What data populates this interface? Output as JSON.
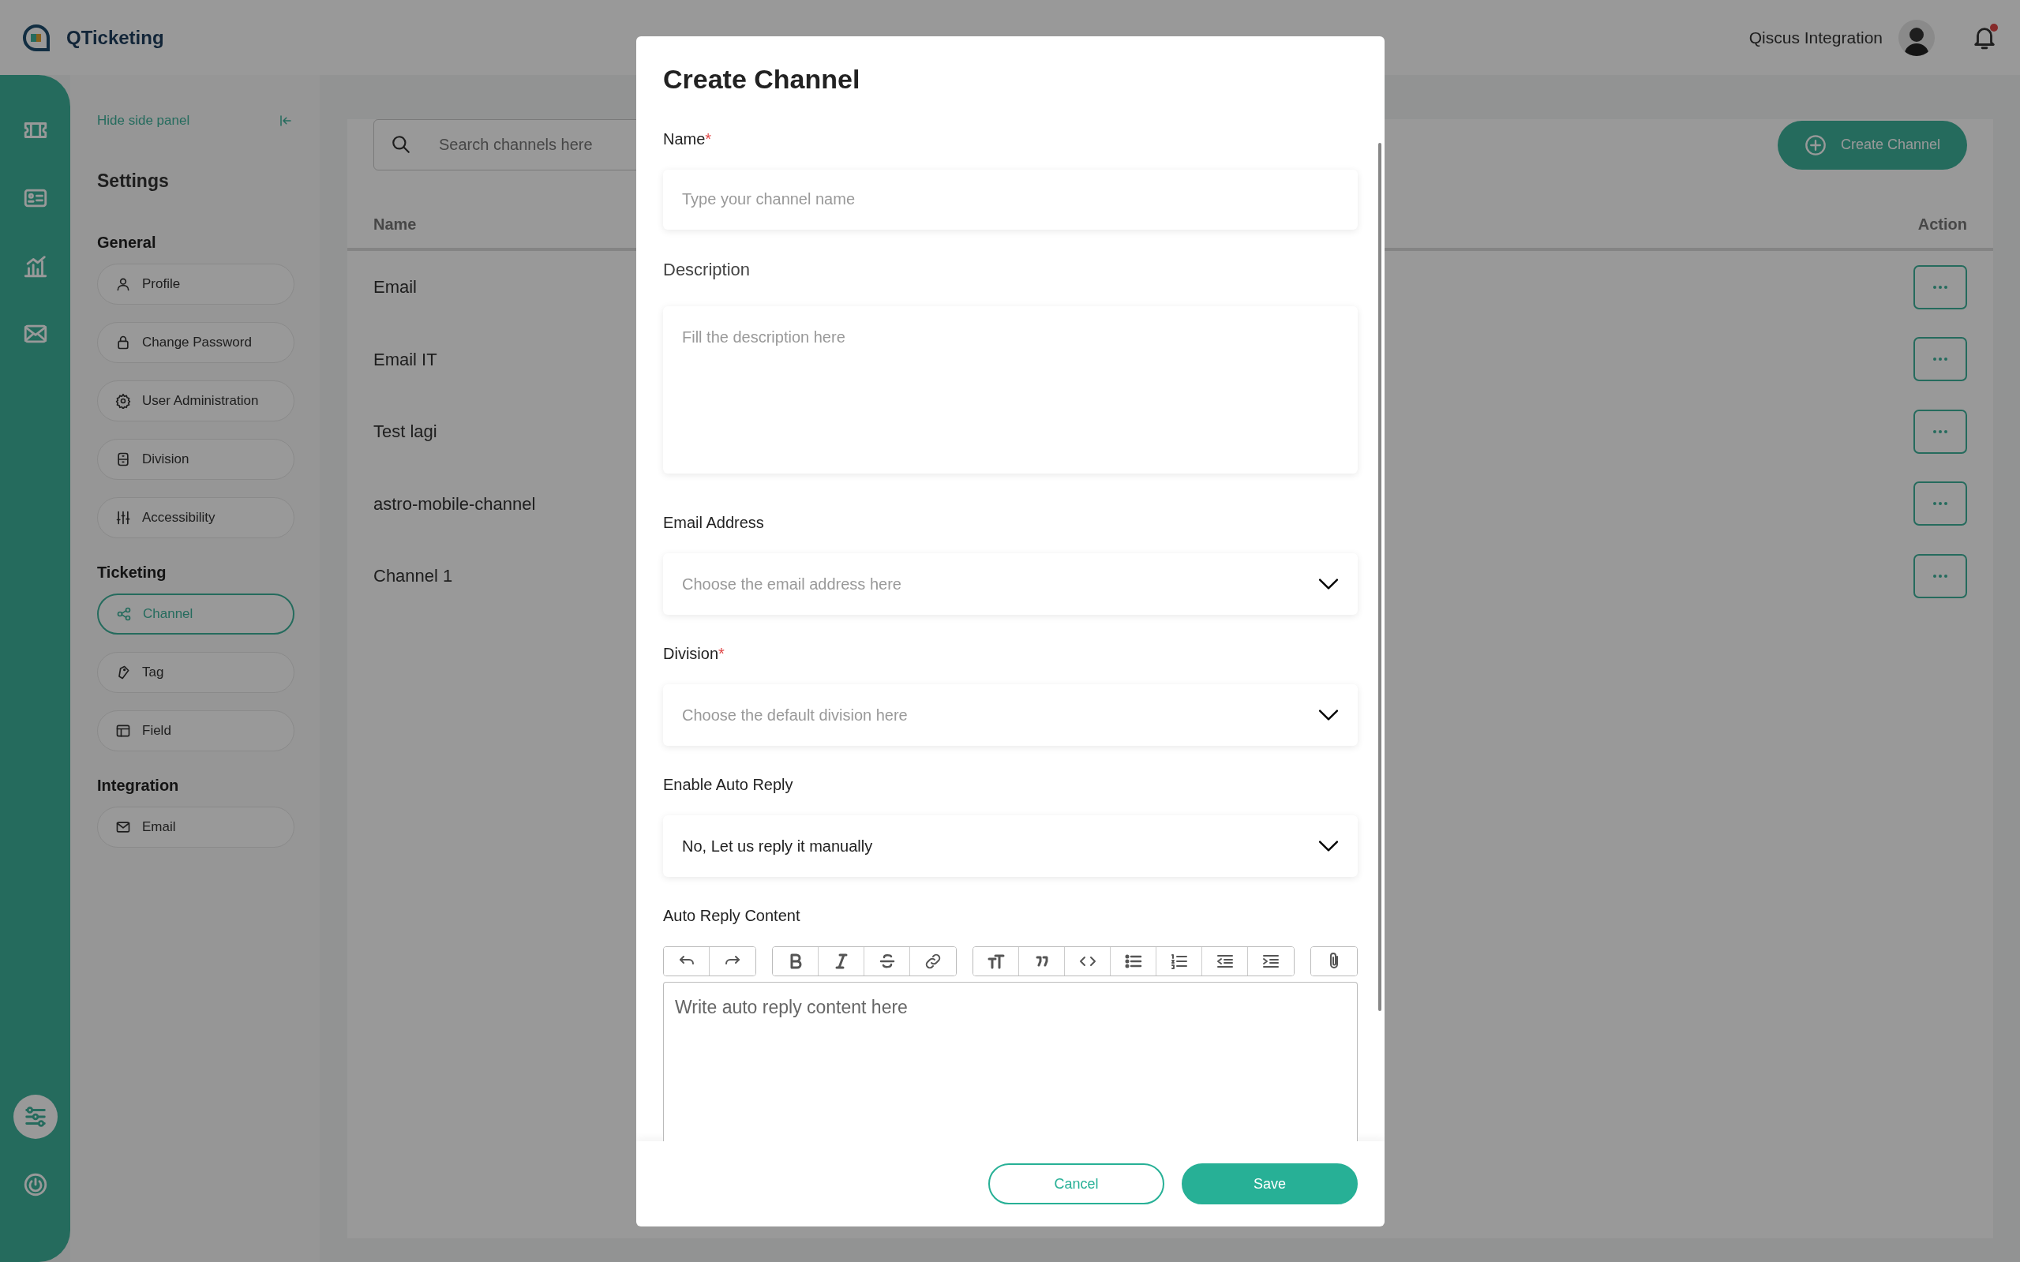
{
  "app": {
    "title": "QTicketing"
  },
  "user": {
    "name": "Qiscus Integration",
    "has_notification": true
  },
  "rail": {
    "items": [
      {
        "selected": false
      },
      {
        "selected": false
      },
      {
        "selected": false
      },
      {
        "selected": false
      },
      {
        "selected": true
      },
      {
        "selected": false
      }
    ]
  },
  "side_panel": {
    "hide_label": "Hide side panel",
    "title": "Settings",
    "sections": [
      {
        "heading": "General",
        "items": [
          {
            "label": "Profile",
            "selected": false
          },
          {
            "label": "Change Password",
            "selected": false
          },
          {
            "label": "User Administration",
            "selected": false
          },
          {
            "label": "Division",
            "selected": false
          },
          {
            "label": "Accessibility",
            "selected": false
          }
        ]
      },
      {
        "heading": "Ticketing",
        "items": [
          {
            "label": "Channel",
            "selected": true
          },
          {
            "label": "Tag",
            "selected": false
          },
          {
            "label": "Field",
            "selected": false
          }
        ]
      },
      {
        "heading": "Integration",
        "items": [
          {
            "label": "Email",
            "selected": false
          }
        ]
      }
    ]
  },
  "channels": {
    "search": {
      "placeholder": "Search channels here"
    },
    "create_button": "Create Channel",
    "columns": [
      "Name",
      "Action"
    ],
    "rows": [
      {
        "name": "Email"
      },
      {
        "name": "Email IT"
      },
      {
        "name": "Test lagi"
      },
      {
        "name": "astro-mobile-channel"
      },
      {
        "name": "Channel 1"
      }
    ]
  },
  "modal": {
    "title": "Create Channel",
    "fields": [
      {
        "kind": "text",
        "label": "Name",
        "required_mark": "*",
        "placeholder": "Type your channel name"
      },
      {
        "kind": "textarea",
        "label": "Description",
        "placeholder": "Fill the description here"
      },
      {
        "kind": "select",
        "label": "Email Address",
        "placeholder": "Choose the email address here"
      },
      {
        "kind": "select",
        "label": "Division",
        "required_mark": "*",
        "placeholder": "Choose the default division here"
      },
      {
        "kind": "select",
        "label": "Enable Auto Reply",
        "value": "No, Let us reply it manually"
      },
      {
        "kind": "editor",
        "label": "Auto Reply Content",
        "placeholder": "Write auto reply content here"
      }
    ],
    "buttons": [
      {
        "label": "Cancel",
        "kind": "secondary"
      },
      {
        "label": "Save",
        "kind": "primary"
      }
    ]
  }
}
